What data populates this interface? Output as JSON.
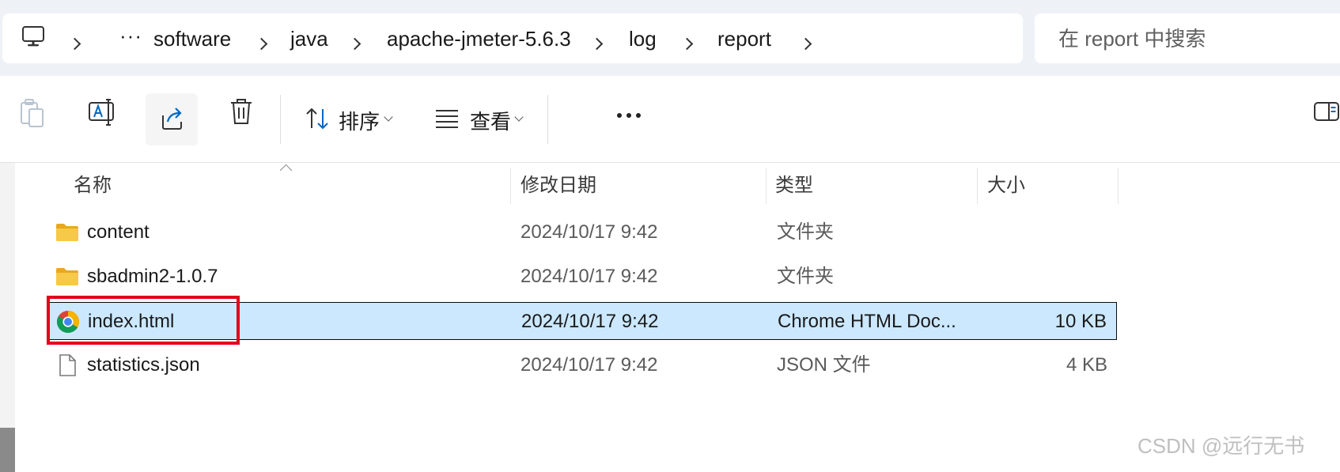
{
  "address_bar": {
    "overflow": "···",
    "crumbs": [
      "software",
      "java",
      "apache-jmeter-5.6.3",
      "log",
      "report"
    ]
  },
  "search": {
    "placeholder": "在 report 中搜索"
  },
  "toolbar": {
    "sort_label": "排序",
    "view_label": "查看",
    "more_label": "更多"
  },
  "columns": {
    "name": "名称",
    "date": "修改日期",
    "type": "类型",
    "size": "大小"
  },
  "files": [
    {
      "name": "content",
      "date": "2024/10/17 9:42",
      "type": "文件夹",
      "size": "",
      "icon": "folder-icon"
    },
    {
      "name": "sbadmin2-1.0.7",
      "date": "2024/10/17 9:42",
      "type": "文件夹",
      "size": "",
      "icon": "folder-icon"
    },
    {
      "name": "index.html",
      "date": "2024/10/17 9:42",
      "type": "Chrome HTML Doc...",
      "size": "10 KB",
      "icon": "chrome-icon",
      "selected": true
    },
    {
      "name": "statistics.json",
      "date": "2024/10/17 9:42",
      "type": "JSON 文件",
      "size": "4 KB",
      "icon": "file-icon"
    }
  ],
  "watermark": "CSDN @远行无书",
  "colors": {
    "selection": "#cce8ff",
    "highlight_box": "#e3001b",
    "folder": "#f7c948",
    "accent": "#0067c0"
  }
}
